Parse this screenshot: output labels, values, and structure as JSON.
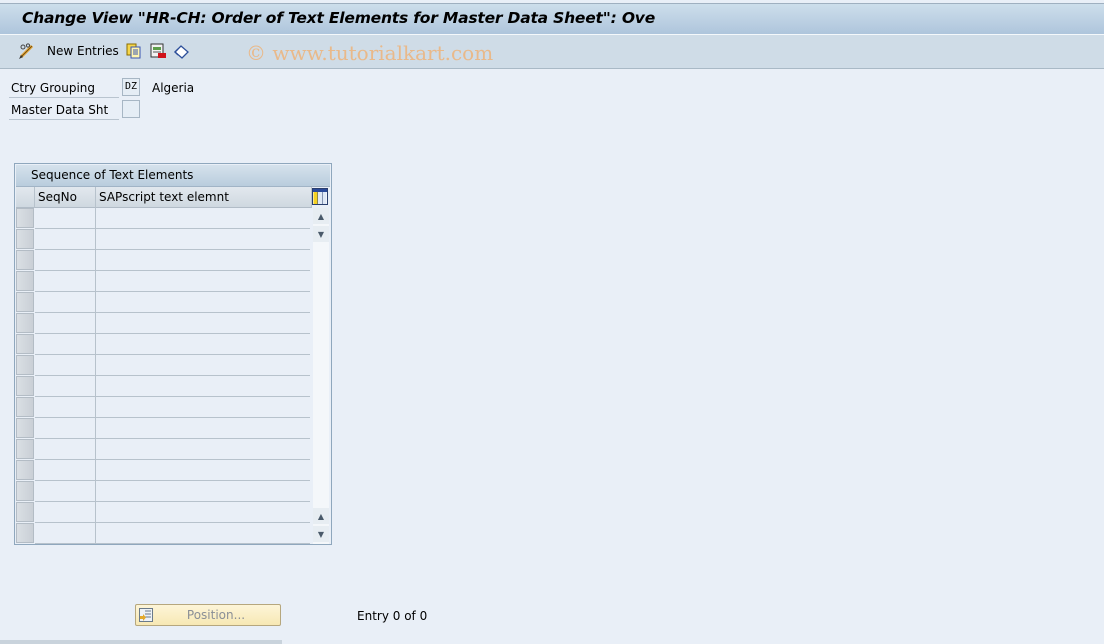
{
  "window": {
    "title": "Change View \"HR-CH: Order of Text Elements for Master Data Sheet\": Ove"
  },
  "toolbar": {
    "items": [
      {
        "icon": "pencil-glasses-icon",
        "label": ""
      },
      {
        "icon": "",
        "label": "New Entries"
      },
      {
        "icon": "copy-icon",
        "label": ""
      },
      {
        "icon": "delete-icon",
        "label": ""
      },
      {
        "icon": "undo-icon",
        "label": ""
      }
    ],
    "watermark": "© www.tutorialkart.com"
  },
  "form": {
    "ctry_grouping": {
      "label": "Ctry Grouping",
      "value": "DZ",
      "description": "Algeria"
    },
    "master_data_sheet": {
      "label": "Master Data Sht",
      "value": ""
    }
  },
  "table": {
    "title": "Sequence of Text Elements",
    "columns": [
      "SeqNo",
      "SAPscript text elemnt"
    ],
    "row_count_visible": 16,
    "rows": []
  },
  "footer": {
    "position_button": "Position...",
    "entry_status": "Entry 0 of 0"
  }
}
